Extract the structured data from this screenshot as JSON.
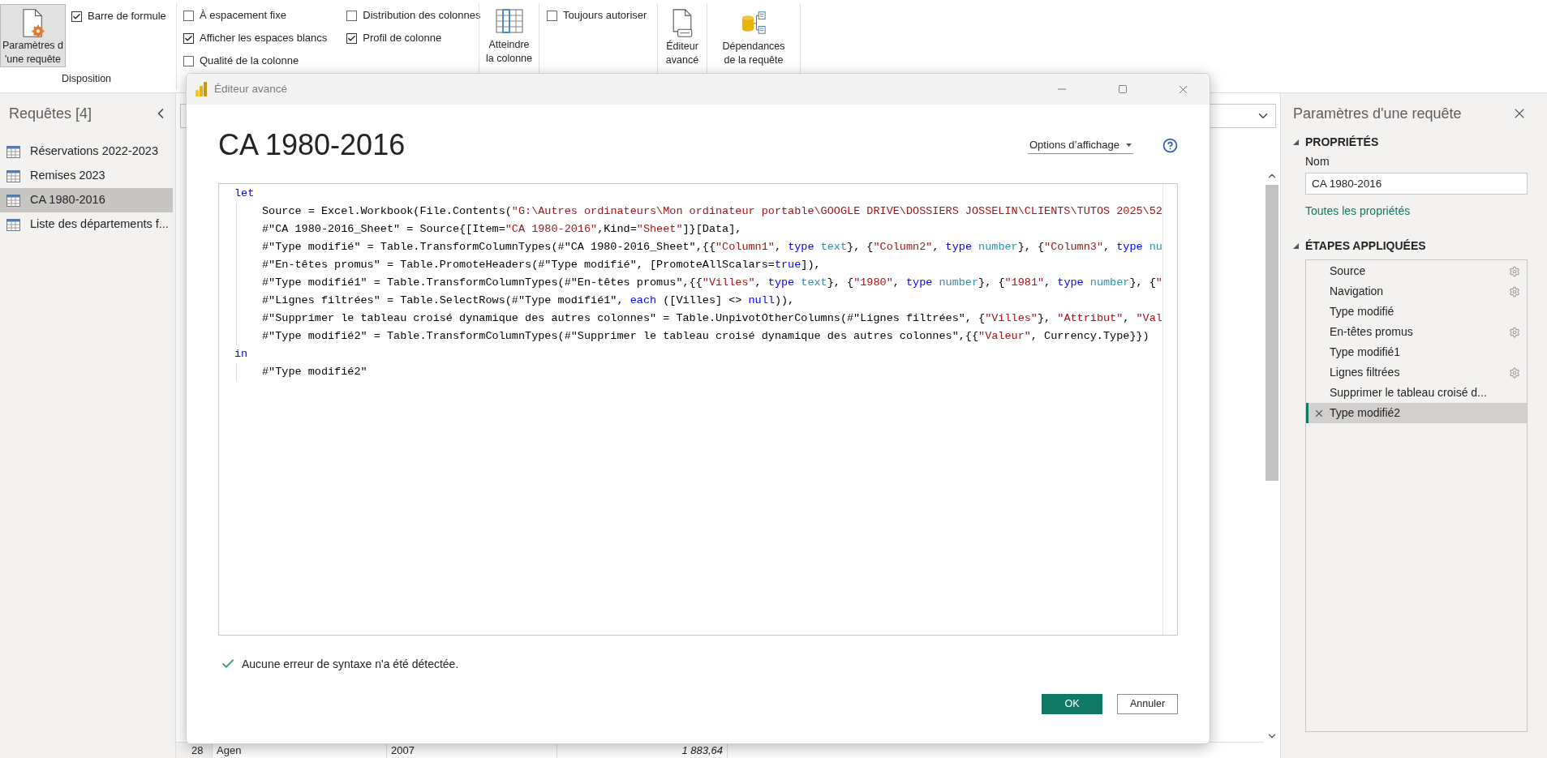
{
  "ribbon": {
    "query_settings_button": {
      "label_lines": [
        "Paramètres d",
        "'une requête"
      ],
      "pressed": true
    },
    "layout_checkboxes": [
      {
        "label": "Barre de formule",
        "checked": true
      }
    ],
    "layout_group_label": "Disposition",
    "view_checkboxes": [
      {
        "label": "À espacement fixe",
        "checked": false
      },
      {
        "label": "Afficher les espaces blancs",
        "checked": true
      },
      {
        "label": "Qualité de la colonne",
        "checked": false
      },
      {
        "label": "Distribution des colonnes",
        "checked": false
      },
      {
        "label": "Profil de colonne",
        "checked": true
      }
    ],
    "go_to_column_button": {
      "label_lines": [
        "Atteindre",
        "la colonne"
      ]
    },
    "parameter_checkboxes": [
      {
        "label": "Toujours autoriser",
        "checked": false
      }
    ],
    "advanced_editor_button": {
      "label_lines": [
        "Éditeur",
        "avancé"
      ]
    },
    "dependencies_button": {
      "label_lines": [
        "Dépendances",
        "de la requête"
      ]
    }
  },
  "queries": {
    "title": "Requêtes [4]",
    "items": [
      {
        "label": "Réservations 2022-2023",
        "selected": false
      },
      {
        "label": "Remises 2023",
        "selected": false
      },
      {
        "label": "CA 1980-2016",
        "selected": true
      },
      {
        "label": "Liste des départements f...",
        "selected": false
      }
    ]
  },
  "grid": {
    "visible_row": {
      "number": "28",
      "cells": [
        {
          "text": "Agen",
          "kind": "text"
        },
        {
          "text": "2007",
          "kind": "text"
        },
        {
          "text": "1 883,64",
          "kind": "number"
        }
      ]
    }
  },
  "dialog": {
    "title": "Éditeur avancé",
    "heading": "CA 1980-2016",
    "options_button": "Options d’affichage",
    "code": [
      {
        "tokens": [
          {
            "kind": "keyword",
            "text": "let"
          }
        ],
        "children": [
          {
            "tokens": [
              {
                "kind": "plain",
                "text": "Source = Excel.Workbook(File.Contents("
              },
              {
                "kind": "string",
                "text": "\"G:\\Autres ordinateurs\\Mon ordinateur portable\\GOOGLE DRIVE\\DOSSIERS JOSSELIN\\CLIENTS\\TUTOS 2025\\52"
              }
            ]
          },
          {
            "tokens": [
              {
                "kind": "plain",
                "text": "#\"CA 1980-2016_Sheet\" = Source{[Item="
              },
              {
                "kind": "string",
                "text": "\"CA 1980-2016\""
              },
              {
                "kind": "plain",
                "text": ",Kind="
              },
              {
                "kind": "string",
                "text": "\"Sheet\""
              },
              {
                "kind": "plain",
                "text": "]}[Data],"
              }
            ]
          },
          {
            "tokens": [
              {
                "kind": "plain",
                "text": "#\"Type modifié\" = Table.TransformColumnTypes(#\"CA 1980-2016_Sheet\",{{"
              },
              {
                "kind": "string",
                "text": "\"Column1\""
              },
              {
                "kind": "plain",
                "text": ", "
              },
              {
                "kind": "keyword",
                "text": "type"
              },
              {
                "kind": "type",
                "text": " text"
              },
              {
                "kind": "plain",
                "text": "}, {"
              },
              {
                "kind": "string",
                "text": "\"Column2\""
              },
              {
                "kind": "plain",
                "text": ", "
              },
              {
                "kind": "keyword",
                "text": "type"
              },
              {
                "kind": "type",
                "text": " number"
              },
              {
                "kind": "plain",
                "text": "}, {"
              },
              {
                "kind": "string",
                "text": "\"Column3\""
              },
              {
                "kind": "plain",
                "text": ", "
              },
              {
                "kind": "keyword",
                "text": "type"
              },
              {
                "kind": "type",
                "text": " nu"
              }
            ]
          },
          {
            "tokens": [
              {
                "kind": "plain",
                "text": "#\"En-têtes promus\" = Table.PromoteHeaders(#\"Type modifié\", [PromoteAllScalars="
              },
              {
                "kind": "keyword",
                "text": "true"
              },
              {
                "kind": "plain",
                "text": "]),"
              }
            ]
          },
          {
            "tokens": [
              {
                "kind": "plain",
                "text": "#\"Type modifié1\" = Table.TransformColumnTypes(#\"En-têtes promus\",{{"
              },
              {
                "kind": "string",
                "text": "\"Villes\""
              },
              {
                "kind": "plain",
                "text": ", "
              },
              {
                "kind": "keyword",
                "text": "type"
              },
              {
                "kind": "type",
                "text": " text"
              },
              {
                "kind": "plain",
                "text": "}, {"
              },
              {
                "kind": "string",
                "text": "\"1980\""
              },
              {
                "kind": "plain",
                "text": ", "
              },
              {
                "kind": "keyword",
                "text": "type"
              },
              {
                "kind": "type",
                "text": " number"
              },
              {
                "kind": "plain",
                "text": "}, {"
              },
              {
                "kind": "string",
                "text": "\"1981\""
              },
              {
                "kind": "plain",
                "text": ", "
              },
              {
                "kind": "keyword",
                "text": "type"
              },
              {
                "kind": "type",
                "text": " number"
              },
              {
                "kind": "plain",
                "text": "}, {"
              },
              {
                "kind": "string",
                "text": "\""
              }
            ]
          },
          {
            "tokens": [
              {
                "kind": "plain",
                "text": "#\"Lignes filtrées\" = Table.SelectRows(#\"Type modifié1\", "
              },
              {
                "kind": "keyword",
                "text": "each"
              },
              {
                "kind": "plain",
                "text": " ([Villes] <> "
              },
              {
                "kind": "keyword",
                "text": "null"
              },
              {
                "kind": "plain",
                "text": ")),"
              }
            ]
          },
          {
            "tokens": [
              {
                "kind": "plain",
                "text": "#\"Supprimer le tableau croisé dynamique des autres colonnes\" = Table.UnpivotOtherColumns(#\"Lignes filtrées\", {"
              },
              {
                "kind": "string",
                "text": "\"Villes\""
              },
              {
                "kind": "plain",
                "text": "}, "
              },
              {
                "kind": "string",
                "text": "\"Attribut\""
              },
              {
                "kind": "plain",
                "text": ", "
              },
              {
                "kind": "string",
                "text": "\"Val"
              }
            ]
          },
          {
            "tokens": [
              {
                "kind": "plain",
                "text": "#\"Type modifié2\" = Table.TransformColumnTypes(#\"Supprimer le tableau croisé dynamique des autres colonnes\",{{"
              },
              {
                "kind": "string",
                "text": "\"Valeur\""
              },
              {
                "kind": "plain",
                "text": ", Currency.Type}})"
              }
            ]
          }
        ]
      },
      {
        "tokens": [
          {
            "kind": "keyword",
            "text": "in"
          }
        ],
        "children": [
          {
            "tokens": [
              {
                "kind": "plain",
                "text": "#\"Type modifié2\""
              }
            ]
          }
        ]
      }
    ],
    "status": {
      "text": "Aucune erreur de syntaxe n'a été détectée.",
      "ok": true
    },
    "buttons": [
      {
        "label": "OK",
        "kind": "primary"
      },
      {
        "label": "Annuler",
        "kind": "secondary"
      }
    ]
  },
  "settings_panel": {
    "title": "Paramètres d'une requête",
    "properties": {
      "heading": "PROPRIÉTÉS",
      "name_label": "Nom",
      "name_value": "CA 1980-2016",
      "all_properties_link": "Toutes les propriétés"
    },
    "steps": {
      "heading": "ÉTAPES APPLIQUÉES",
      "items": [
        {
          "label": "Source",
          "settings": true,
          "selected": false
        },
        {
          "label": "Navigation",
          "settings": true,
          "selected": false
        },
        {
          "label": "Type modifié",
          "settings": false,
          "selected": false
        },
        {
          "label": "En-têtes promus",
          "settings": true,
          "selected": false
        },
        {
          "label": "Type modifié1",
          "settings": false,
          "selected": false
        },
        {
          "label": "Lignes filtrées",
          "settings": true,
          "selected": false
        },
        {
          "label": "Supprimer le tableau croisé d...",
          "settings": false,
          "selected": false
        },
        {
          "label": "Type modifié2",
          "settings": false,
          "selected": true
        }
      ]
    }
  }
}
